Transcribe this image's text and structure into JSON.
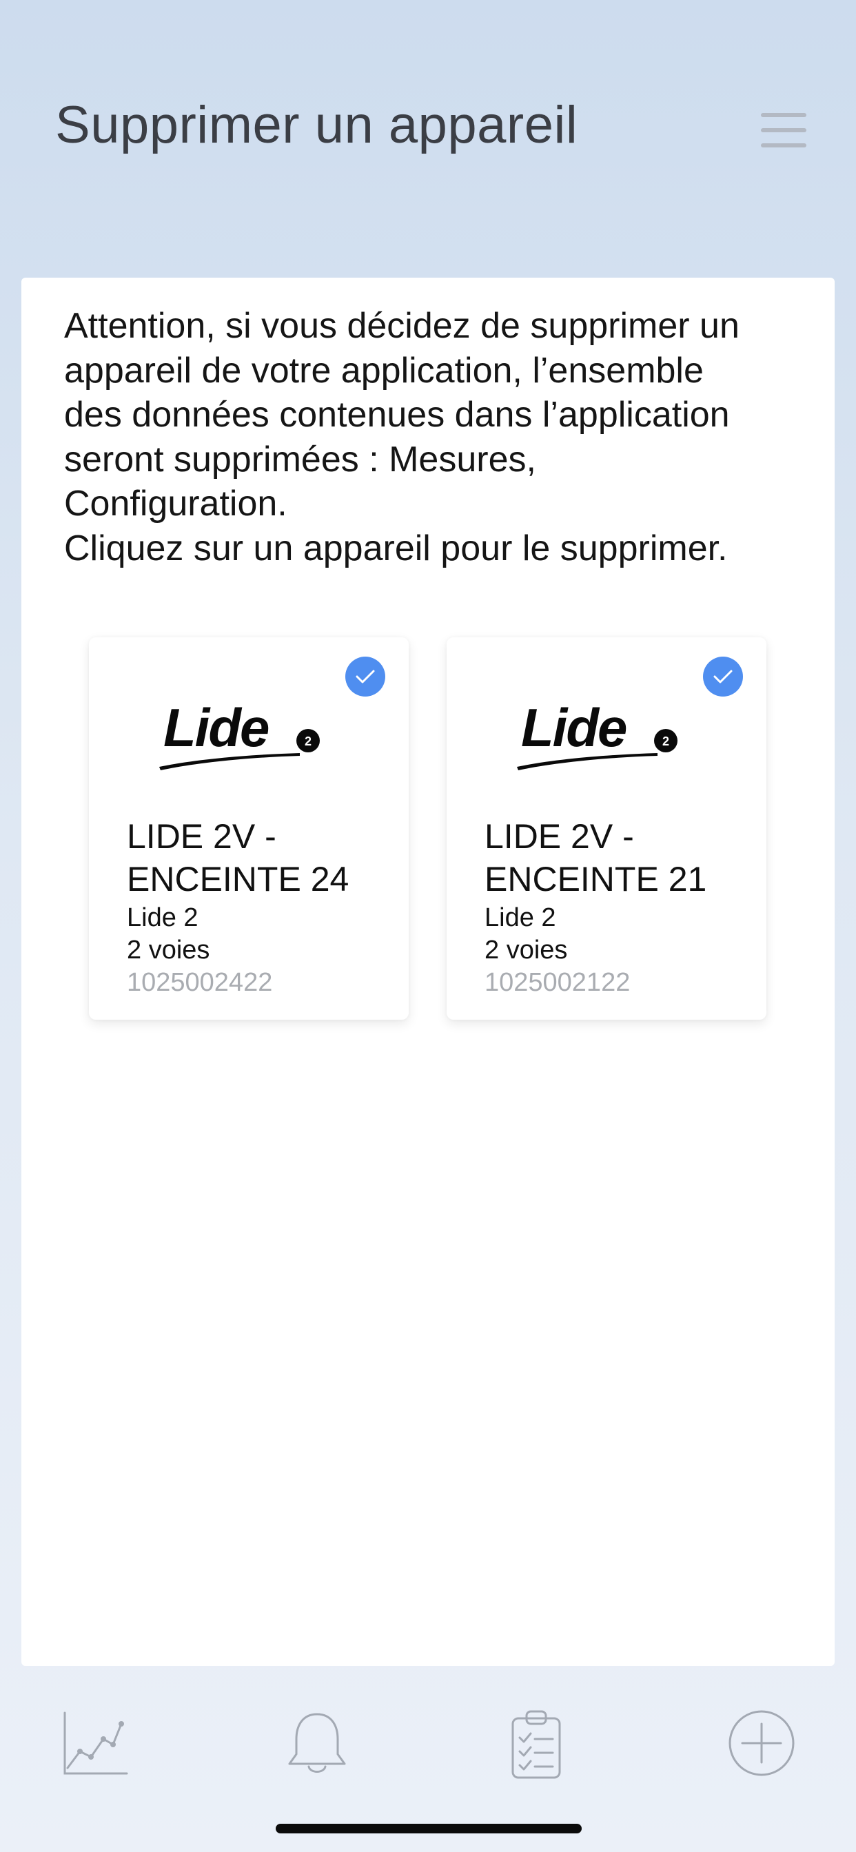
{
  "header": {
    "title": "Supprimer un appareil",
    "menu_icon": "hamburger-menu-icon"
  },
  "warning": {
    "lines": [
      "Attention, si vous décidez de supprimer un",
      "appareil de votre application, l’ensemble",
      "des données contenues dans l’application",
      "seront supprimées : Mesures,",
      "Configuration.",
      "Cliquez sur un appareil pour le supprimer."
    ]
  },
  "devices": [
    {
      "logo_text": "Lide",
      "logo_badge": "2",
      "name_line1": "LIDE 2V -",
      "name_line2": "ENCEINTE 24",
      "model": "Lide 2",
      "channels": "2 voies",
      "serial": "1025002422",
      "selected": true
    },
    {
      "logo_text": "Lide",
      "logo_badge": "2",
      "name_line1": "LIDE 2V -",
      "name_line2": "ENCEINTE 21",
      "model": "Lide 2",
      "channels": "2 voies",
      "serial": "1025002122",
      "selected": true
    }
  ],
  "tabbar": {
    "icons": [
      "chart-line-icon",
      "bell-icon",
      "clipboard-checklist-icon",
      "plus-circle-icon"
    ]
  },
  "colors": {
    "accent": "#4f8ef0",
    "icon_gray": "#a3a9b3",
    "serial_gray": "#a9acb1",
    "title_gray": "#3b3e45"
  }
}
